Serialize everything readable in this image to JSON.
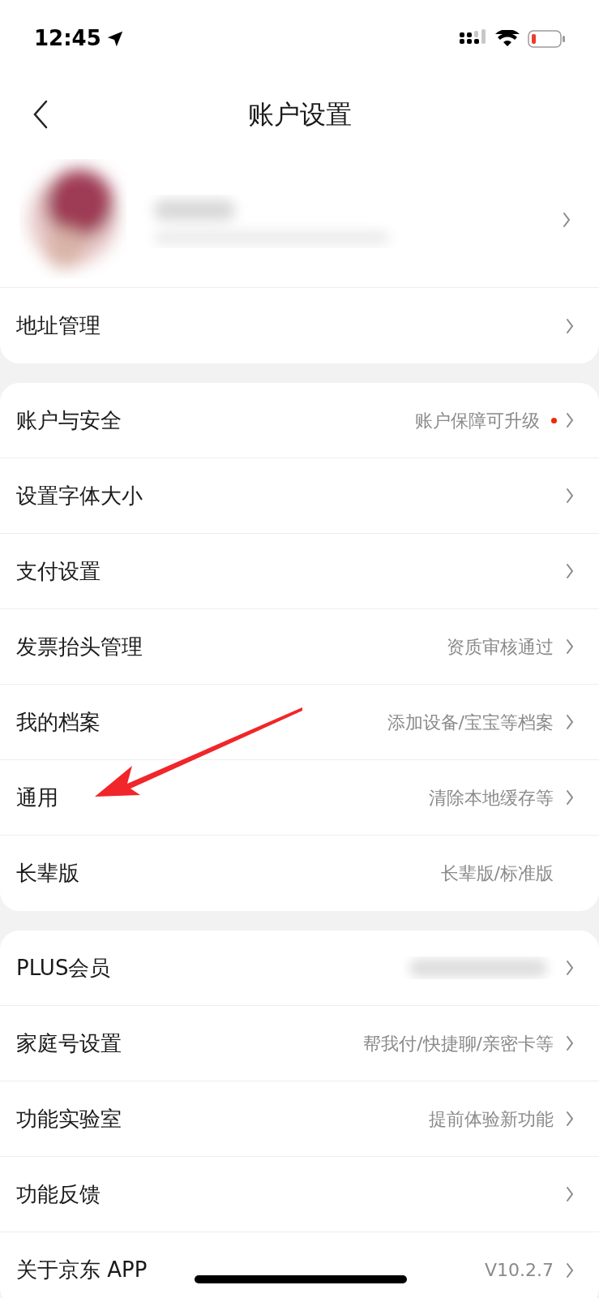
{
  "status_bar": {
    "time": "12:45"
  },
  "nav": {
    "title": "账户设置"
  },
  "sections": [
    [
      {
        "kind": "profile",
        "chevron": true
      },
      {
        "kind": "row",
        "label": "地址管理",
        "chevron": true
      }
    ],
    [
      {
        "kind": "row",
        "label": "账户与安全",
        "value": "账户保障可升级",
        "dot": true,
        "chevron": true
      },
      {
        "kind": "row",
        "label": "设置字体大小",
        "chevron": true
      },
      {
        "kind": "row",
        "label": "支付设置",
        "chevron": true
      },
      {
        "kind": "row",
        "label": "发票抬头管理",
        "value": "资质审核通过",
        "chevron": true
      },
      {
        "kind": "row",
        "label": "我的档案",
        "value": "添加设备/宝宝等档案",
        "chevron": true
      },
      {
        "kind": "row",
        "label": "通用",
        "value": "清除本地缓存等",
        "chevron": true
      },
      {
        "kind": "row",
        "label": "长辈版",
        "value": "长辈版/标准版",
        "chevron": false
      }
    ],
    [
      {
        "kind": "row",
        "label": "PLUS会员",
        "blurred": true,
        "chevron": true
      },
      {
        "kind": "row",
        "label": "家庭号设置",
        "value": "帮我付/快捷聊/亲密卡等",
        "chevron": true
      },
      {
        "kind": "row",
        "label": "功能实验室",
        "value": "提前体验新功能",
        "chevron": true
      },
      {
        "kind": "row",
        "label": "功能反馈",
        "chevron": true
      },
      {
        "kind": "row",
        "label": "关于京东 APP",
        "value": "V10.2.7",
        "chevron": true
      }
    ]
  ]
}
